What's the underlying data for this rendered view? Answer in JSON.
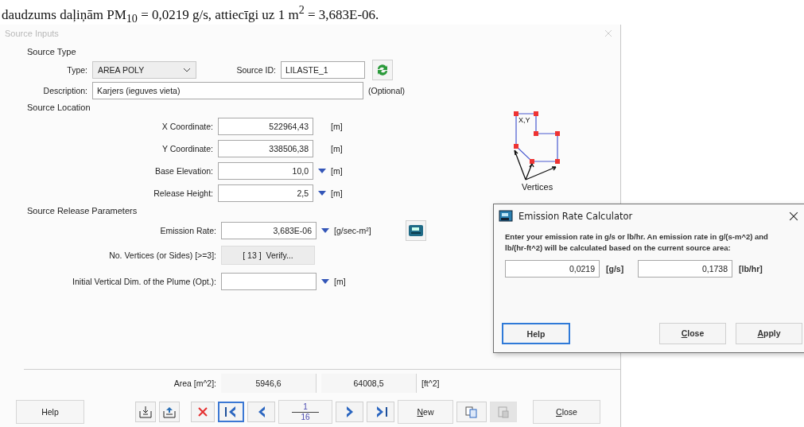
{
  "document_text": "daudzums daļiņām PM$_{10}$ = 0,0219 g/s, attiecīgi uz 1 m$^{2}$ = 3,683E-06.",
  "window": {
    "title": "Source Inputs"
  },
  "source_type": {
    "heading": "Source Type",
    "type_label": "Type:",
    "type_value": "AREA POLY",
    "source_id_label": "Source ID:",
    "source_id_value": "LILASTE_1",
    "description_label": "Description:",
    "description_value": "Karjers (ieguves vieta)",
    "optional_note": "(Optional)"
  },
  "source_location": {
    "heading": "Source Location",
    "fields": [
      {
        "label": "X Coordinate:",
        "value": "522964,43",
        "unit": "[m]",
        "dropdown": false
      },
      {
        "label": "Y Coordinate:",
        "value": "338506,38",
        "unit": "[m]",
        "dropdown": false
      },
      {
        "label": "Base Elevation:",
        "value": "10,0",
        "unit": "[m]",
        "dropdown": true
      },
      {
        "label": "Release Height:",
        "value": "2,5",
        "unit": "[m]",
        "dropdown": true
      }
    ],
    "diagram": {
      "corner_label": "X,Y",
      "caption": "Vertices"
    }
  },
  "release_parameters": {
    "heading": "Source Release Parameters",
    "emission": {
      "label": "Emission Rate:",
      "value": "3,683E-06",
      "unit": "[g/sec-m²]",
      "dropdown": true
    },
    "vertices": {
      "label": "No. Vertices (or Sides) [>=3]:",
      "button": "[ 13 ]  Verify..."
    },
    "plume": {
      "label": "Initial Vertical Dim. of the Plume (Opt.):",
      "unit": "[m]",
      "dropdown": true
    }
  },
  "area": {
    "label": "Area [m^2]:",
    "m2": "5946,6",
    "ft2": "64008,5",
    "ft2_unit": "[ft^2]"
  },
  "toolbar": {
    "help": "Help",
    "page_current": "1",
    "page_total": "16",
    "new": "New",
    "close": "Close",
    "paste_disabled": true
  },
  "calculator": {
    "title": "Emission Rate Calculator",
    "message": "Enter your emission rate in g/s or lb/hr.  An emission rate in g/(s-m^2) and lb/(hr-ft^2) will be calculated based on the current source area:",
    "fields": [
      {
        "value": "0,0219",
        "unit": "[g/s]"
      },
      {
        "value": "0,1738",
        "unit": "[lb/hr]"
      }
    ],
    "buttons": [
      {
        "label": "Help",
        "focused": true,
        "mnemonic": false
      },
      {
        "label": "Close",
        "focused": false,
        "mnemonic": true
      },
      {
        "label": "Apply",
        "focused": false,
        "mnemonic": true
      }
    ]
  }
}
